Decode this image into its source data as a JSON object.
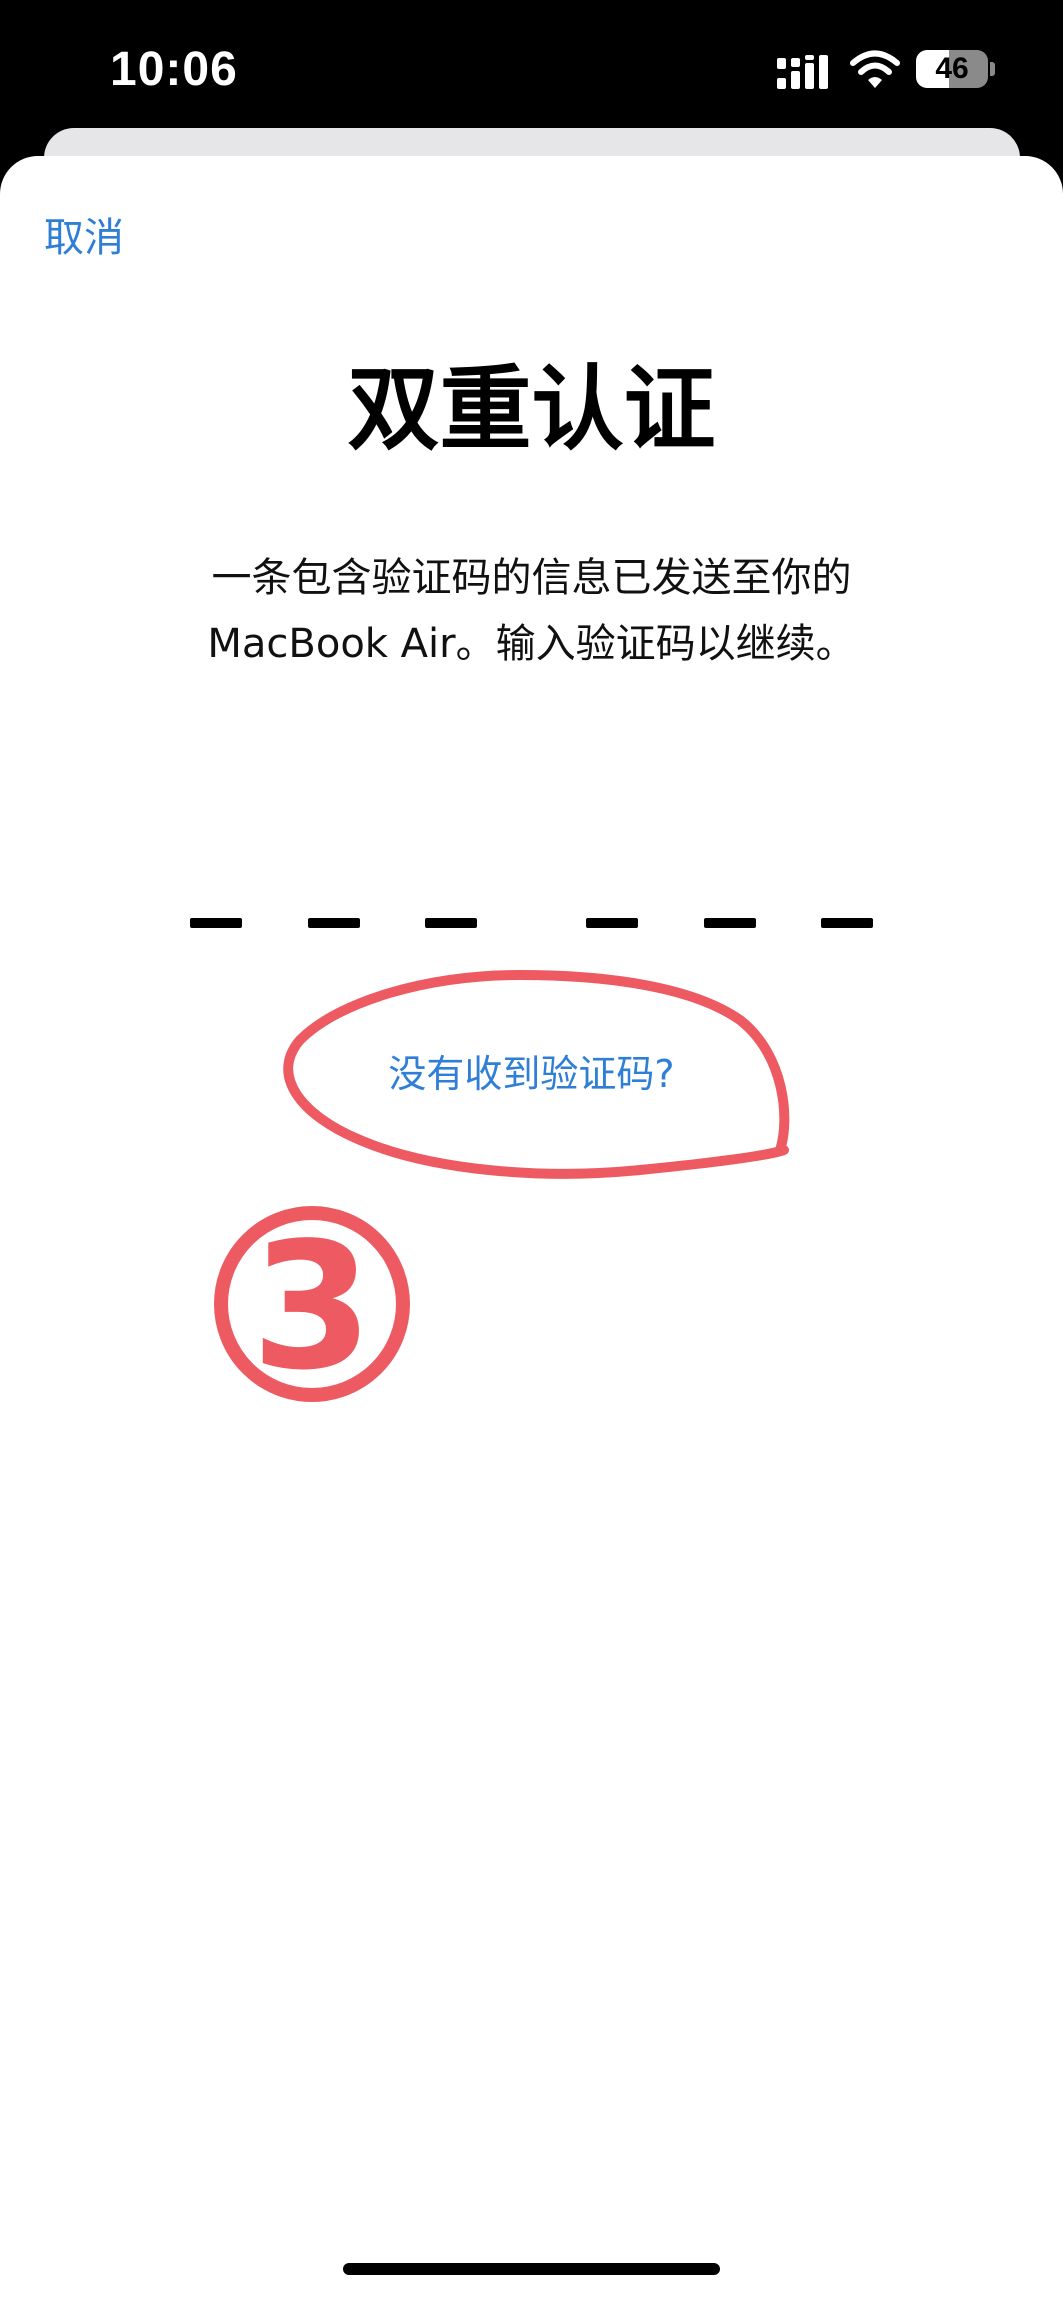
{
  "status_bar": {
    "time": "10:06",
    "battery_level": "46",
    "icons": [
      "signal-icon",
      "wifi-icon",
      "battery-icon"
    ]
  },
  "nav": {
    "cancel_label": "取消"
  },
  "main": {
    "title": "双重认证",
    "subtitle_line1": "一条包含验证码的信息已发送至你的",
    "subtitle_line2": "MacBook Air。输入验证码以继续。",
    "code_slots": 6,
    "help_link": "没有收到验证码?"
  },
  "annotation": {
    "step_number": "③",
    "color": "#ee5a61"
  },
  "colors": {
    "accent": "#2f7fd6",
    "background": "#ffffff"
  }
}
